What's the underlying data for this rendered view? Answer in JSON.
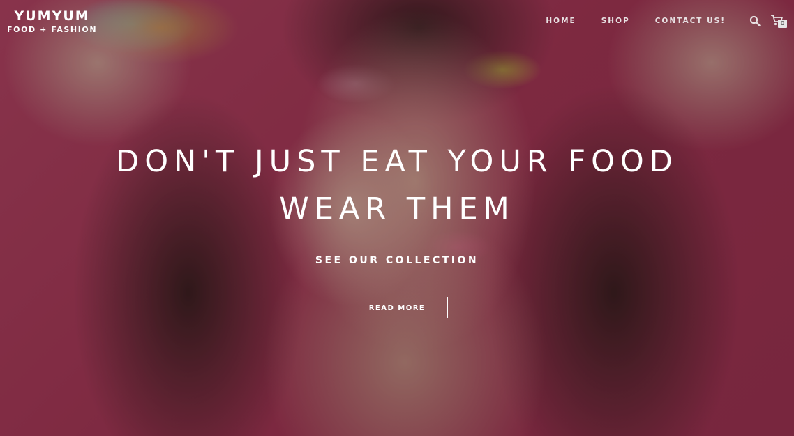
{
  "brand": {
    "name": "YUMYUM",
    "tagline": "FOOD + FASHION"
  },
  "nav": {
    "items": [
      {
        "label": "HOME"
      },
      {
        "label": "SHOP"
      },
      {
        "label": "CONTACT US!"
      }
    ]
  },
  "header_icons": {
    "search_icon": "search-icon",
    "cart_icon": "cart-icon",
    "cart_count": "0"
  },
  "hero": {
    "headline_line1": "DON'T JUST EAT YOUR FOOD",
    "headline_line2": "WEAR THEM",
    "subtitle": "SEE OUR COLLECTION",
    "button_label": "READ MORE"
  },
  "colors": {
    "text": "#ffffff",
    "background_pink": "#b23a5a"
  }
}
